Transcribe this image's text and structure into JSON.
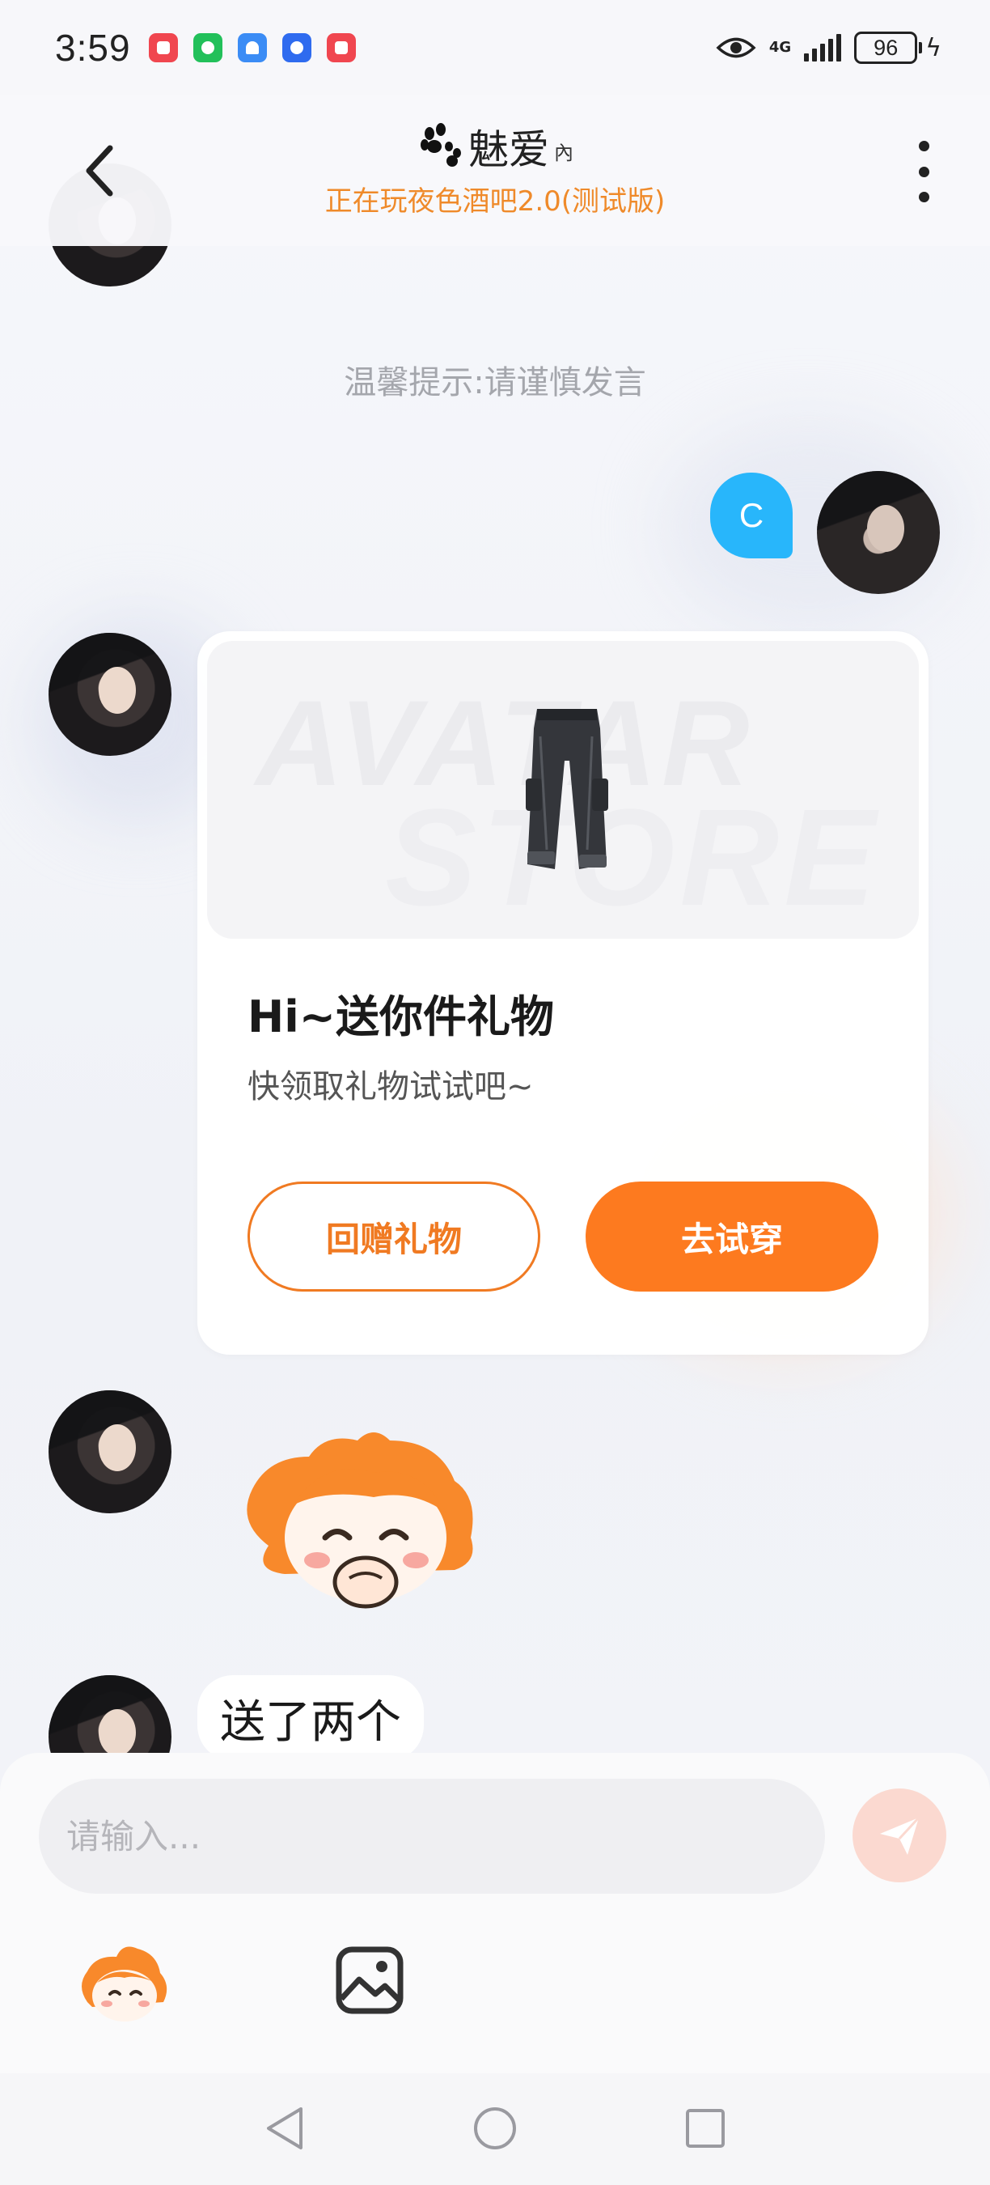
{
  "status_bar": {
    "time": "3:59",
    "network": "4G",
    "battery": "96",
    "notif_colors": [
      "#f0464f",
      "#22c05a",
      "#3b8cf5",
      "#2f6bef",
      "#f0464f"
    ]
  },
  "header": {
    "title": "魅爱",
    "title_badge": "內",
    "subtitle": "正在玩夜色酒吧2.0(测试版)"
  },
  "chat": {
    "tip": "温馨提示:请谨慎发言",
    "my_message": "C",
    "gift_card": {
      "watermark_line1": "AVATAR",
      "watermark_line2": "STORE",
      "title": "Hi~送你件礼物",
      "subtitle": "快领取礼物试试吧~",
      "return_gift_label": "回赠礼物",
      "try_on_label": "去试穿"
    },
    "last_message": "送了两个"
  },
  "input": {
    "placeholder": "请输入..."
  },
  "colors": {
    "accent": "#fd7a1f",
    "subtitle": "#ef8a2a",
    "my_bubble": "#28b6fb"
  }
}
